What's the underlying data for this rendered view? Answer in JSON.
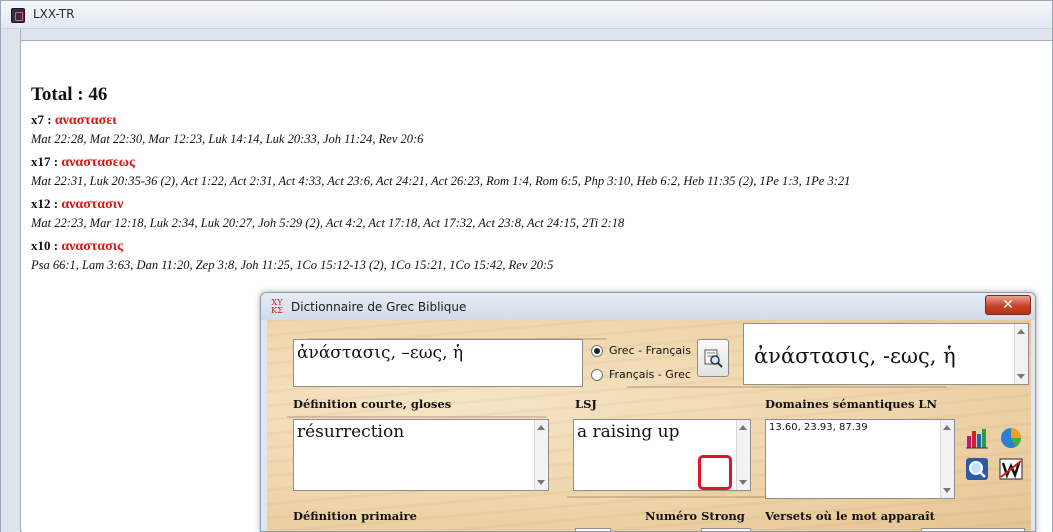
{
  "main_window": {
    "title": "LXX-TR"
  },
  "results": {
    "total": "Total : 46",
    "entries": [
      {
        "count": "x7 :",
        "form": "αναστασει",
        "refs": "Mat 22:28, Mat 22:30, Mar 12:23, Luk 14:14, Luk 20:33, Joh 11:24, Rev 20:6"
      },
      {
        "count": "x17 :",
        "form": "αναστασεως",
        "refs": "Mat 22:31, Luk 20:35-36 (2), Act 1:22, Act 2:31, Act 4:33, Act 23:6, Act 24:21, Act 26:23, Rom 1:4, Rom 6:5, Php 3:10, Heb 6:2, Heb 11:35 (2), 1Pe 1:3, 1Pe 3:21"
      },
      {
        "count": "x12 :",
        "form": "αναστασιν",
        "refs": "Mat 22:23, Mar 12:18, Luk 2:34, Luk 20:27, Joh 5:29 (2), Act 4:2, Act 17:18, Act 17:32, Act 23:8, Act 24:15, 2Ti 2:18"
      },
      {
        "count": "x10 :",
        "form": "αναστασις",
        "refs": "Psa 66:1, Lam 3:63, Dan 11:20, Zep 3:8, Joh 11:25, 1Co 15:12-13 (2), 1Co 15:21, 1Co 15:42, Rev 20:5"
      }
    ]
  },
  "dictionary": {
    "title": "Dictionnaire de Grec Biblique",
    "icon_text": "XY KΣ",
    "close_label": "✕",
    "search_value": "ἀνάστασις, –εως, ἡ",
    "radio_options": [
      {
        "label": "Grec - Français",
        "selected": true
      },
      {
        "label": "Français - Grec",
        "selected": false
      }
    ],
    "headword": "ἀνάστασις, -εως, ἡ",
    "short_def_label": "Définition courte, gloses",
    "short_def_value": "résurrection",
    "lsj_label": "LSJ",
    "lsj_value": "a raising up",
    "ln_label": "Domaines sémantiques LN",
    "ln_value": "13.60,  23.93,  87.39",
    "primary_def_label": "Définition primaire",
    "strong_label": "Numéro Strong",
    "verses_label": "Versets où le mot apparaît"
  },
  "icons": [
    "bar-chart-icon",
    "pie-chart-icon",
    "magnifier-icon",
    "word-icon",
    "search-icon"
  ],
  "colors": {
    "greek_form": "#e01010",
    "highlight": "#e0142a"
  }
}
